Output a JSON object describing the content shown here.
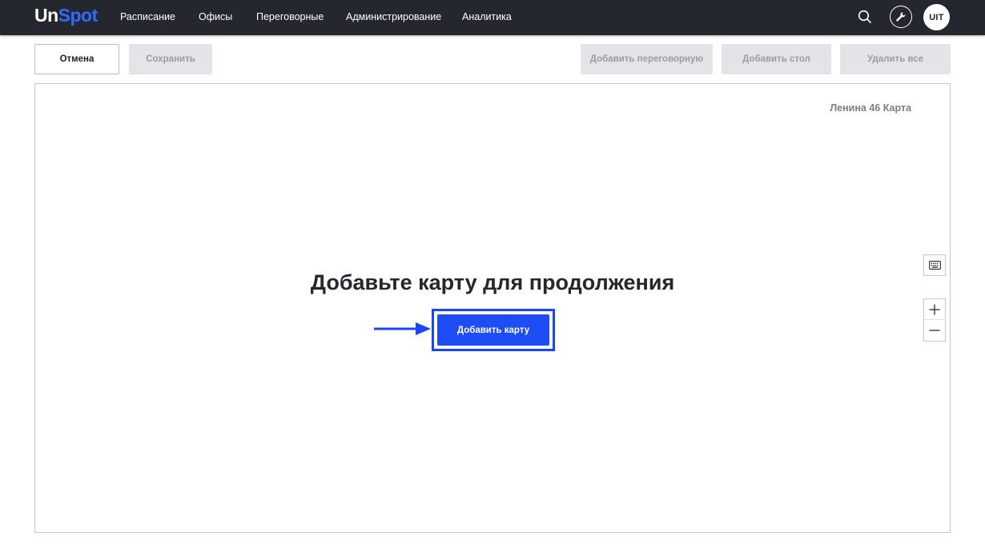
{
  "app": {
    "logo_part1": "Un",
    "logo_part2": "Spot",
    "accent": "#1e4cf5",
    "header_bg": "#25272e"
  },
  "nav": [
    {
      "label": "Расписание"
    },
    {
      "label": "Офисы"
    },
    {
      "label": "Переговорные"
    },
    {
      "label": "Администрирование"
    },
    {
      "label": "Аналитика"
    }
  ],
  "header_actions": {
    "search_icon": "search-icon",
    "tools_icon": "wrench-icon",
    "avatar_text": "UIT"
  },
  "toolbar": {
    "cancel": "Отмена",
    "save": "Сохранить",
    "add_room": "Добавить переговорную",
    "add_desk": "Добавить стол",
    "delete_all": "Удалить все"
  },
  "map": {
    "name": "Ленина 46 Карта",
    "prompt": "Добавьте карту для продолжения",
    "add_map_button": "Добавить карту"
  },
  "map_controls": {
    "keyboard_icon": "keyboard-icon",
    "zoom_in_icon": "plus-icon",
    "zoom_out_icon": "minus-icon"
  }
}
